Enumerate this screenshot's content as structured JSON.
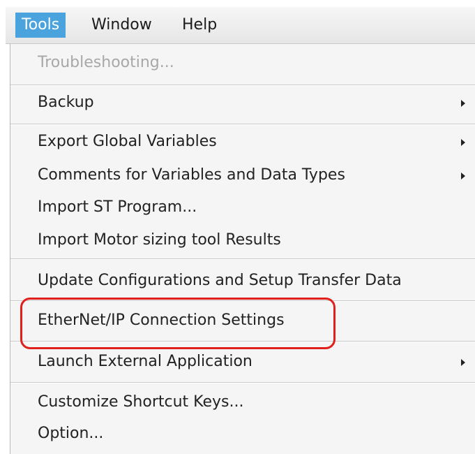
{
  "menubar": {
    "items": [
      {
        "label": "Tools",
        "active": true
      },
      {
        "label": "Window"
      },
      {
        "label": "Help"
      }
    ]
  },
  "menu": {
    "items": [
      {
        "label": "Troubleshooting...",
        "disabled": true
      },
      {
        "label": "Backup",
        "submenu": true
      },
      {
        "label": "Export Global Variables",
        "submenu": true
      },
      {
        "label": "Comments for Variables and Data Types",
        "submenu": true
      },
      {
        "label": "Import ST Program..."
      },
      {
        "label": "Import Motor sizing tool Results"
      },
      {
        "label": "Update Configurations and Setup Transfer Data"
      },
      {
        "label": "EtherNet/IP Connection Settings",
        "highlighted": true
      },
      {
        "label": "Launch External Application",
        "submenu": true
      },
      {
        "label": "Customize Shortcut Keys..."
      },
      {
        "label": "Option..."
      }
    ]
  },
  "colors": {
    "active_menubar": "#4ba3dd",
    "highlight_outline": "#e0201b",
    "disabled_text": "#a8a8a8"
  }
}
